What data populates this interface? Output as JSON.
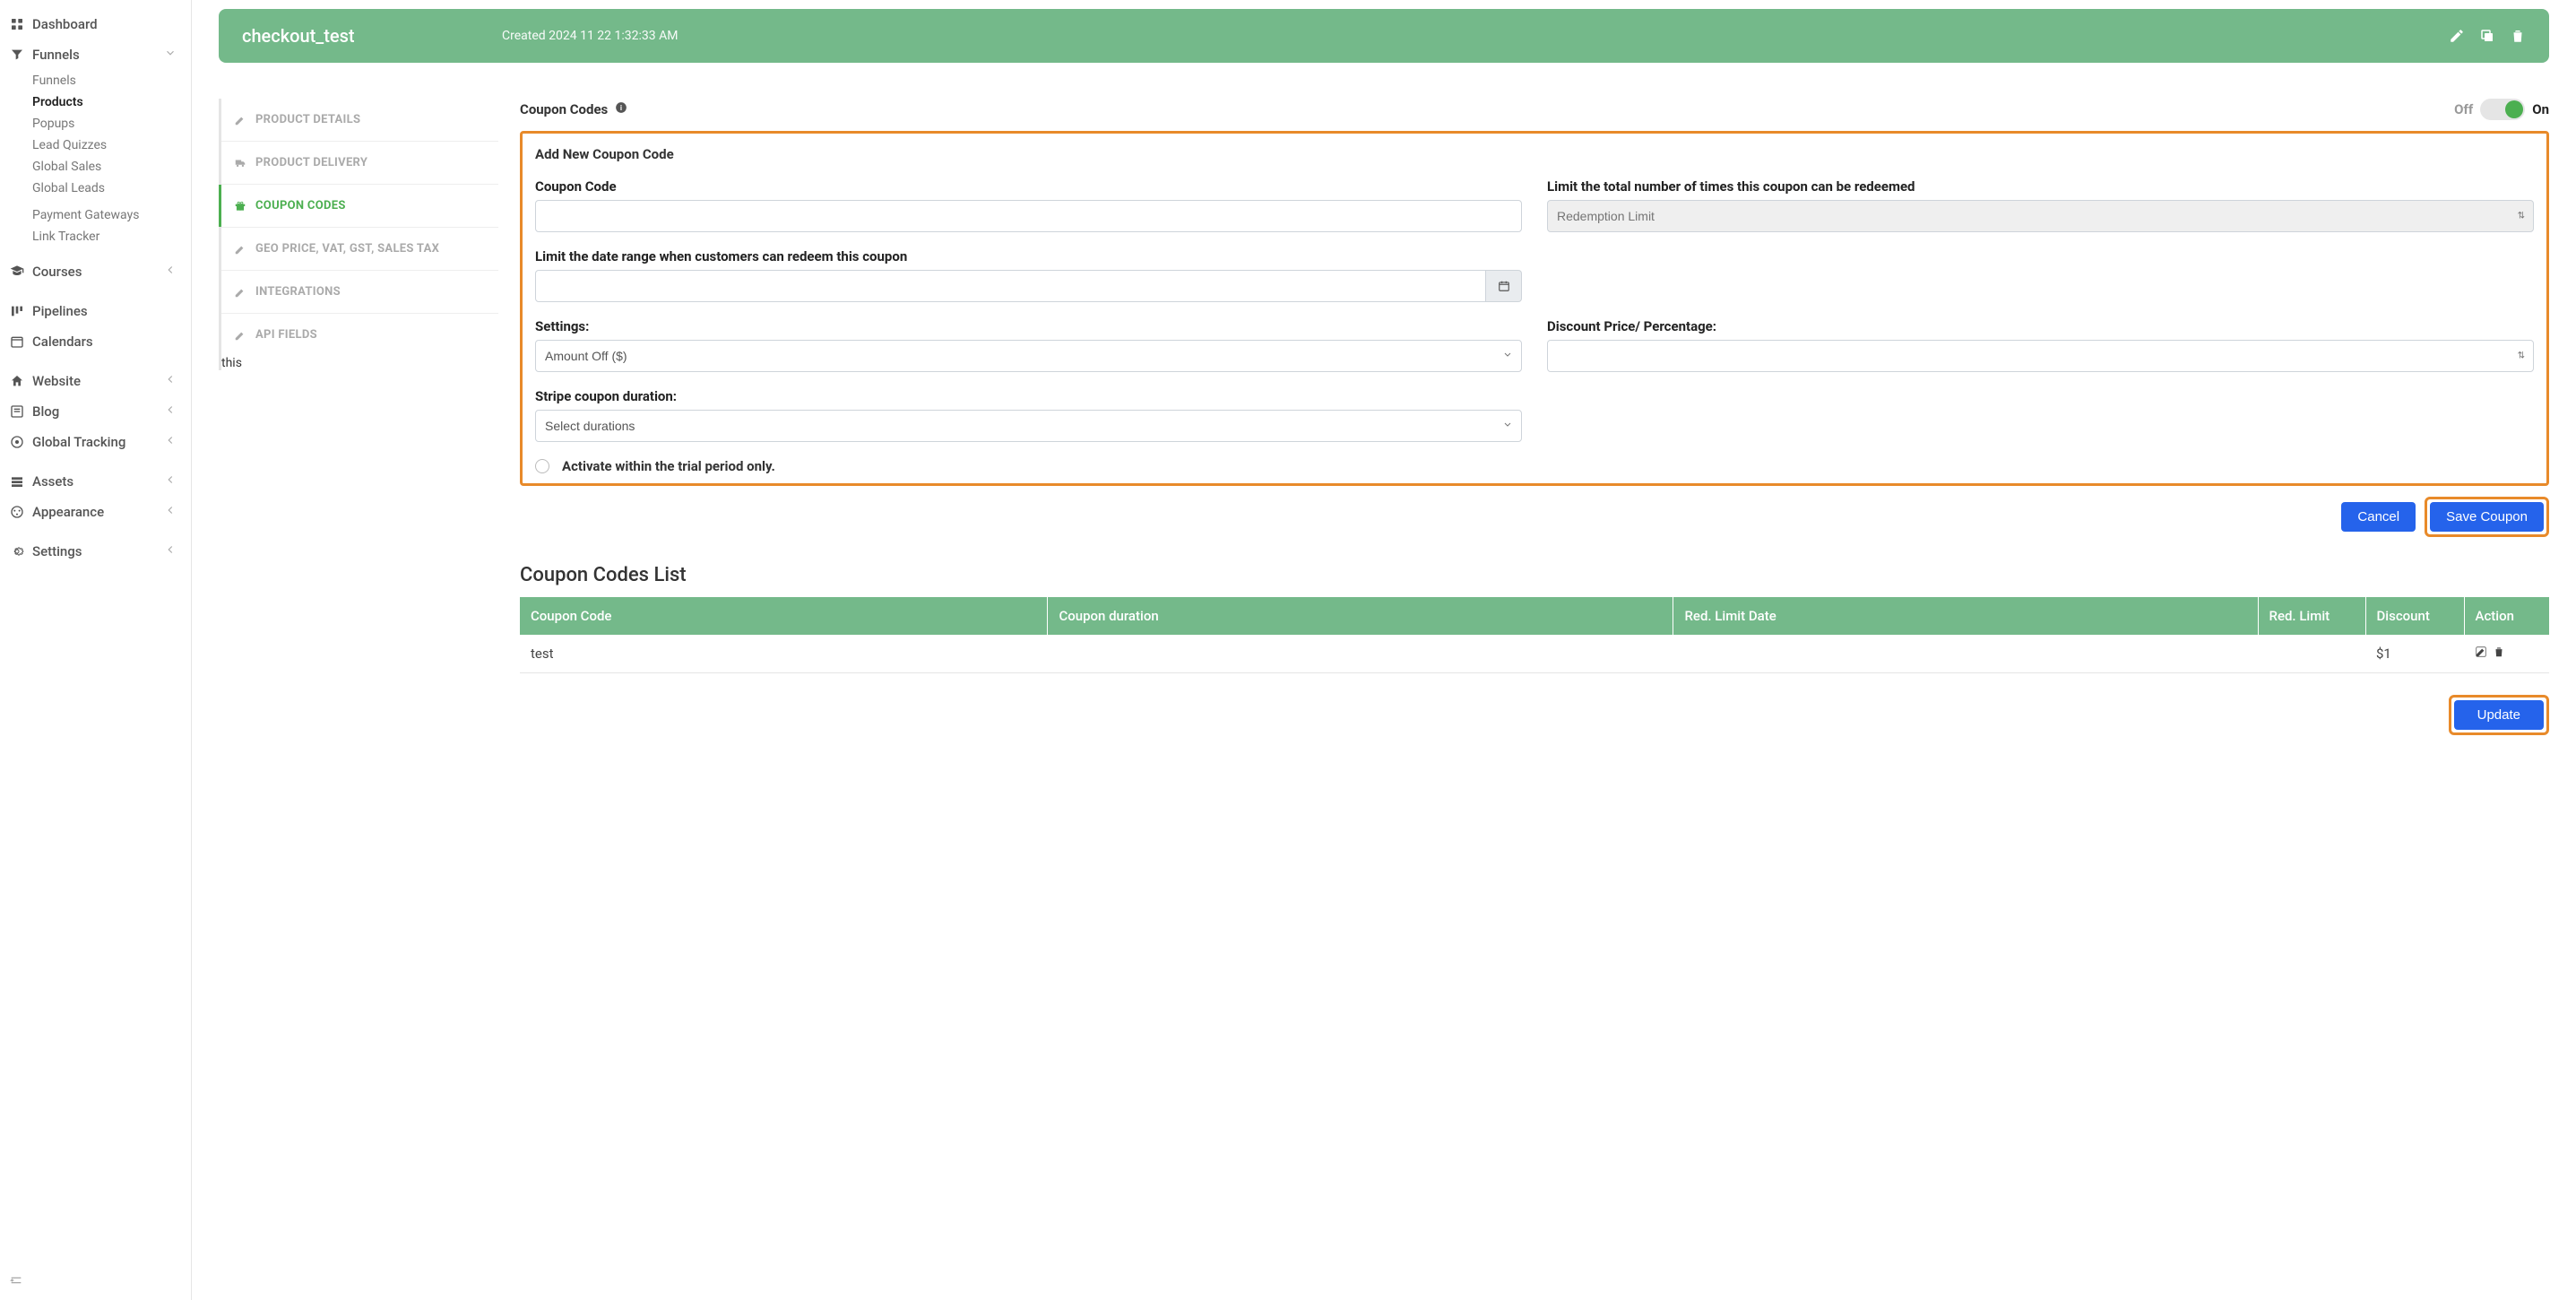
{
  "sidebar": {
    "items": [
      {
        "label": "Dashboard",
        "icon": "dashboard-icon",
        "has_chevron": false
      },
      {
        "label": "Funnels",
        "icon": "funnel-icon",
        "has_chevron": true,
        "chevron": "down",
        "subs": [
          {
            "label": "Funnels"
          },
          {
            "label": "Products",
            "active": true
          },
          {
            "label": "Popups"
          },
          {
            "label": "Lead Quizzes"
          },
          {
            "label": "Global Sales"
          },
          {
            "label": "Global Leads"
          },
          {
            "label": "Payment Gateways"
          },
          {
            "label": "Link Tracker"
          }
        ]
      },
      {
        "label": "Courses",
        "icon": "course-icon",
        "has_chevron": true
      },
      {
        "label": "Pipelines",
        "icon": "pipeline-icon",
        "has_chevron": false
      },
      {
        "label": "Calendars",
        "icon": "calendar-icon",
        "has_chevron": false
      },
      {
        "label": "Website",
        "icon": "home-icon",
        "has_chevron": true
      },
      {
        "label": "Blog",
        "icon": "blog-icon",
        "has_chevron": true
      },
      {
        "label": "Global Tracking",
        "icon": "tracking-icon",
        "has_chevron": true
      },
      {
        "label": "Assets",
        "icon": "assets-icon",
        "has_chevron": true
      },
      {
        "label": "Appearance",
        "icon": "appearance-icon",
        "has_chevron": true
      },
      {
        "label": "Settings",
        "icon": "settings-icon",
        "has_chevron": true
      }
    ]
  },
  "header": {
    "title": "checkout_test",
    "created": "Created 2024 11 22 1:32:33 AM"
  },
  "tabs": [
    {
      "label": "PRODUCT DETAILS",
      "icon": "edit"
    },
    {
      "label": "PRODUCT DELIVERY",
      "icon": "truck"
    },
    {
      "label": "COUPON CODES",
      "icon": "gift",
      "active": true
    },
    {
      "label": "GEO PRICE, VAT, GST, SALES TAX",
      "icon": "edit"
    },
    {
      "label": "INTEGRATIONS",
      "icon": "edit"
    },
    {
      "label": "API FIELDS",
      "icon": "edit"
    }
  ],
  "panel": {
    "title": "Coupon Codes",
    "toggle": {
      "off": "Off",
      "on": "On"
    },
    "form_title": "Add New Coupon Code",
    "coupon_code_label": "Coupon Code",
    "limit_total_label": "Limit the total number of times this coupon can be redeemed",
    "redemption_placeholder": "Redemption Limit",
    "date_range_label": "Limit the date range when customers can redeem this coupon",
    "settings_label": "Settings:",
    "settings_value": "Amount Off ($)",
    "discount_label": "Discount Price/ Percentage:",
    "stripe_label": "Stripe coupon duration:",
    "stripe_value": "Select durations",
    "trial_label": "Activate within the trial period only.",
    "cancel_btn": "Cancel",
    "save_btn": "Save Coupon",
    "list_title": "Coupon Codes List",
    "table": {
      "headers": [
        "Coupon Code",
        "Coupon duration",
        "Red. Limit Date",
        "Red. Limit",
        "Discount",
        "Action"
      ],
      "rows": [
        {
          "code": "test",
          "duration": "",
          "limit_date": "",
          "limit": "",
          "discount": "$1"
        }
      ]
    },
    "update_btn": "Update"
  }
}
